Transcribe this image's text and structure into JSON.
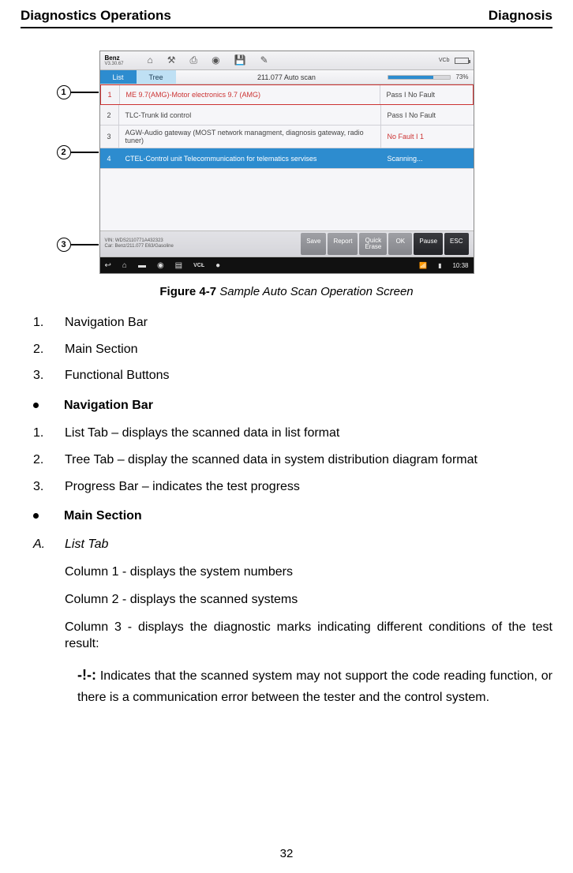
{
  "header": {
    "left": "Diagnostics Operations",
    "right": "Diagnosis"
  },
  "figure": {
    "brand": "Benz",
    "brand_sub": "V3.30.67",
    "tabs": {
      "list": "List",
      "tree": "Tree"
    },
    "scan_title": "211.077 Auto scan",
    "vcl_label": "VCb",
    "progress_pct": "73%",
    "rows": [
      {
        "n": "1",
        "name": "ME 9.7(AMG)-Motor electronics 9.7 (AMG)",
        "status": "Pass I No Fault"
      },
      {
        "n": "2",
        "name": "TLC-Trunk lid control",
        "status": "Pass I No Fault"
      },
      {
        "n": "3",
        "name": "AGW-Audio gateway (MOST network managment, diagnosis gateway, radio tuner)",
        "status": "No Fault I 1"
      },
      {
        "n": "4",
        "name": "CTEL-Control unit Telecommunication for telematics servises",
        "status": "Scanning..."
      }
    ],
    "vin_line1": "VIN: WDS2110771A432323",
    "vin_line2": "Car: Benz/211.077 E63/Gasoline",
    "buttons": {
      "save": "Save",
      "report": "Report",
      "quick_erase": "Quick\nErase",
      "ok": "OK",
      "pause": "Pause",
      "esc": "ESC"
    },
    "clock": "10:38",
    "caption_bold": "Figure 4-7",
    "caption_ital": " Sample Auto Scan Operation Screen"
  },
  "list_top": {
    "i1": "Navigation Bar",
    "i2": "Main Section",
    "i3": "Functional Buttons"
  },
  "section_nav": {
    "head": "Navigation Bar",
    "i1": "List Tab – displays the scanned data in list format",
    "i2": "Tree Tab – display the scanned data in system distribution diagram format",
    "i3": "Progress Bar – indicates the test progress"
  },
  "section_main": {
    "head": "Main Section",
    "sub_letter": "A.",
    "sub_label": "List Tab",
    "col1": "Column 1 - displays the system numbers",
    "col2": "Column 2 - displays the scanned systems",
    "col3": "Column 3 - displays the diagnostic marks indicating different conditions of the test result:",
    "flag_label": "-!-:",
    "flag_text": " Indicates that the scanned system may not support the code reading function, or there is a communication error between the tester and the control system."
  },
  "page_number": "32"
}
